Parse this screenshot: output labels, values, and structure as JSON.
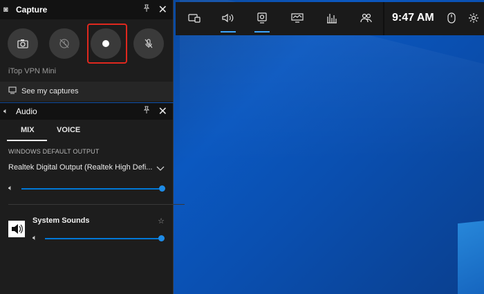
{
  "capture": {
    "title": "Capture",
    "subtitle": "iTop VPN Mini",
    "see_captures_label": "See my captures",
    "icons": {
      "header": "capture-widget-icon",
      "screenshot": "camera-icon",
      "record_last": "record-last-icon",
      "record": "record-dot-icon",
      "mic": "mic-off-icon",
      "captures": "folder-icon"
    }
  },
  "audio": {
    "title": "Audio",
    "tabs": [
      {
        "label": "MIX",
        "selected": true
      },
      {
        "label": "VOICE",
        "selected": false
      }
    ],
    "section_label": "WINDOWS DEFAULT OUTPUT",
    "default_output": "Realtek Digital Output (Realtek High Defi...",
    "master_volume": 1.0,
    "apps": [
      {
        "name": "System Sounds",
        "volume": 1.0,
        "icon": "speaker-icon"
      }
    ]
  },
  "gamebar": {
    "time": "9:47 AM",
    "icons": [
      "widget-menu-icon",
      "audio-icon",
      "capture-icon",
      "performance-icon",
      "resources-icon",
      "social-icon",
      "mouse-icon",
      "settings-icon"
    ]
  },
  "colors": {
    "accent": "#0078d7",
    "record_highlight": "#e0281e",
    "panel_bg": "#1d1d1d",
    "desktop": "#0b58c0"
  }
}
